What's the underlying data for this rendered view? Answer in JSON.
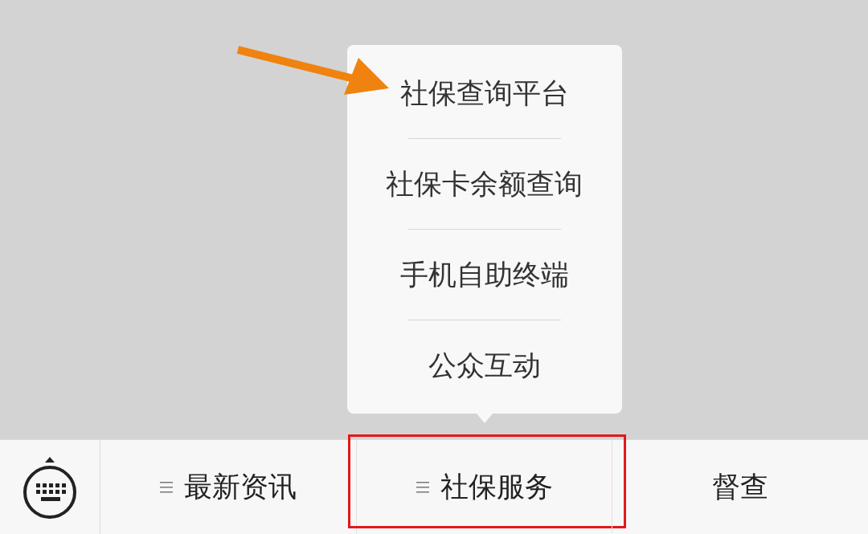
{
  "bottom_bar": {
    "tabs": [
      {
        "label": "最新资讯",
        "has_submenu": true,
        "highlighted": false
      },
      {
        "label": "社保服务",
        "has_submenu": true,
        "highlighted": true,
        "submenu": [
          {
            "label": "社保查询平台"
          },
          {
            "label": "社保卡余额查询"
          },
          {
            "label": "手机自助终端"
          },
          {
            "label": "公众互动"
          }
        ]
      },
      {
        "label": "督查",
        "has_submenu": false,
        "highlighted": false
      }
    ]
  },
  "annotations": [
    {
      "kind": "arrow",
      "color": "#f0820f"
    }
  ]
}
